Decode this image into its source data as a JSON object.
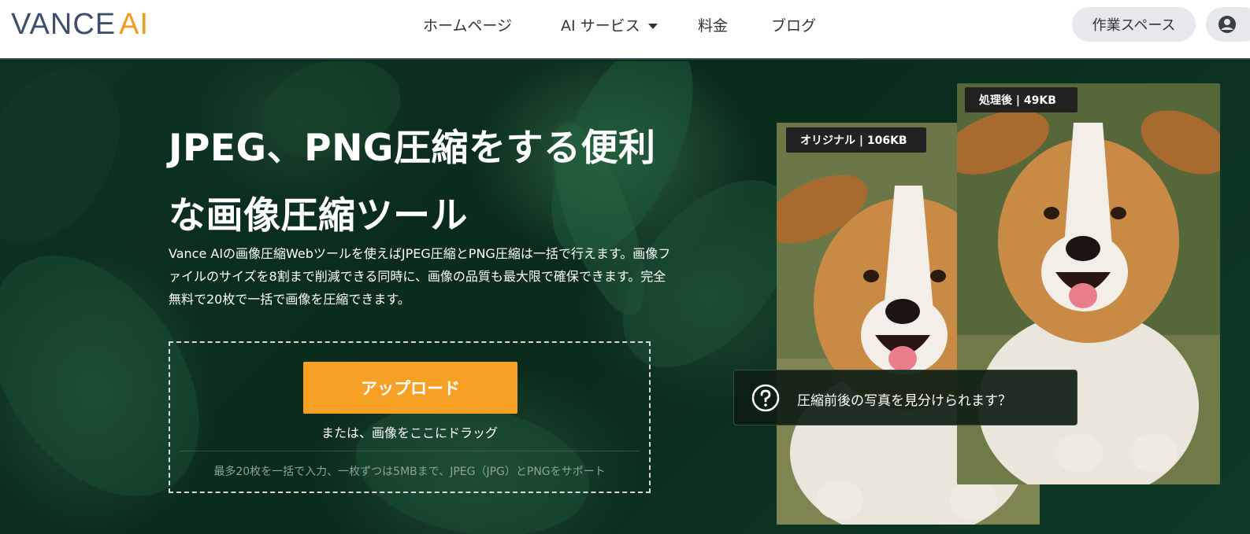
{
  "header": {
    "logo_part1": "VANCE",
    "logo_part2": "AI",
    "nav": {
      "home": "ホームページ",
      "ai_services": "AI サービス",
      "pricing": "料金",
      "blog": "ブログ"
    },
    "workspace_label": "作業スペース"
  },
  "hero": {
    "title": "JPEG、PNG圧縮をする便利な画像圧縮ツール",
    "description": "Vance AIの画像圧縮Webツールを使えばJPEG圧縮とPNG圧縮は一括で行えます。画像ファイルのサイズを8割まで削減できる同時に、画像の品質も最大限で確保できます。完全無料で20枚で一括で画像を圧縮できます。",
    "upload_label": "アップロード",
    "drag_text": "または、画像をここにドラッグ",
    "support_text": "最多20枚を一括で入力、一枚ずつは5MBまで、JPEG（JPG）とPNGをサポート"
  },
  "comparison": {
    "original_tag": "オリジナル | 106KB",
    "processed_tag": "処理後 | 49KB",
    "quiz_text": "圧縮前後の写真を見分けられます？"
  },
  "colors": {
    "accent": "#f7a026",
    "logo_dark": "#3e4f6e",
    "logo_orange": "#f39a1f",
    "hero_bg": "#0b2a1c"
  },
  "icons": {
    "nav_caret": "chevron-down-icon",
    "user": "user-icon",
    "quiz": "question-circle-icon"
  }
}
